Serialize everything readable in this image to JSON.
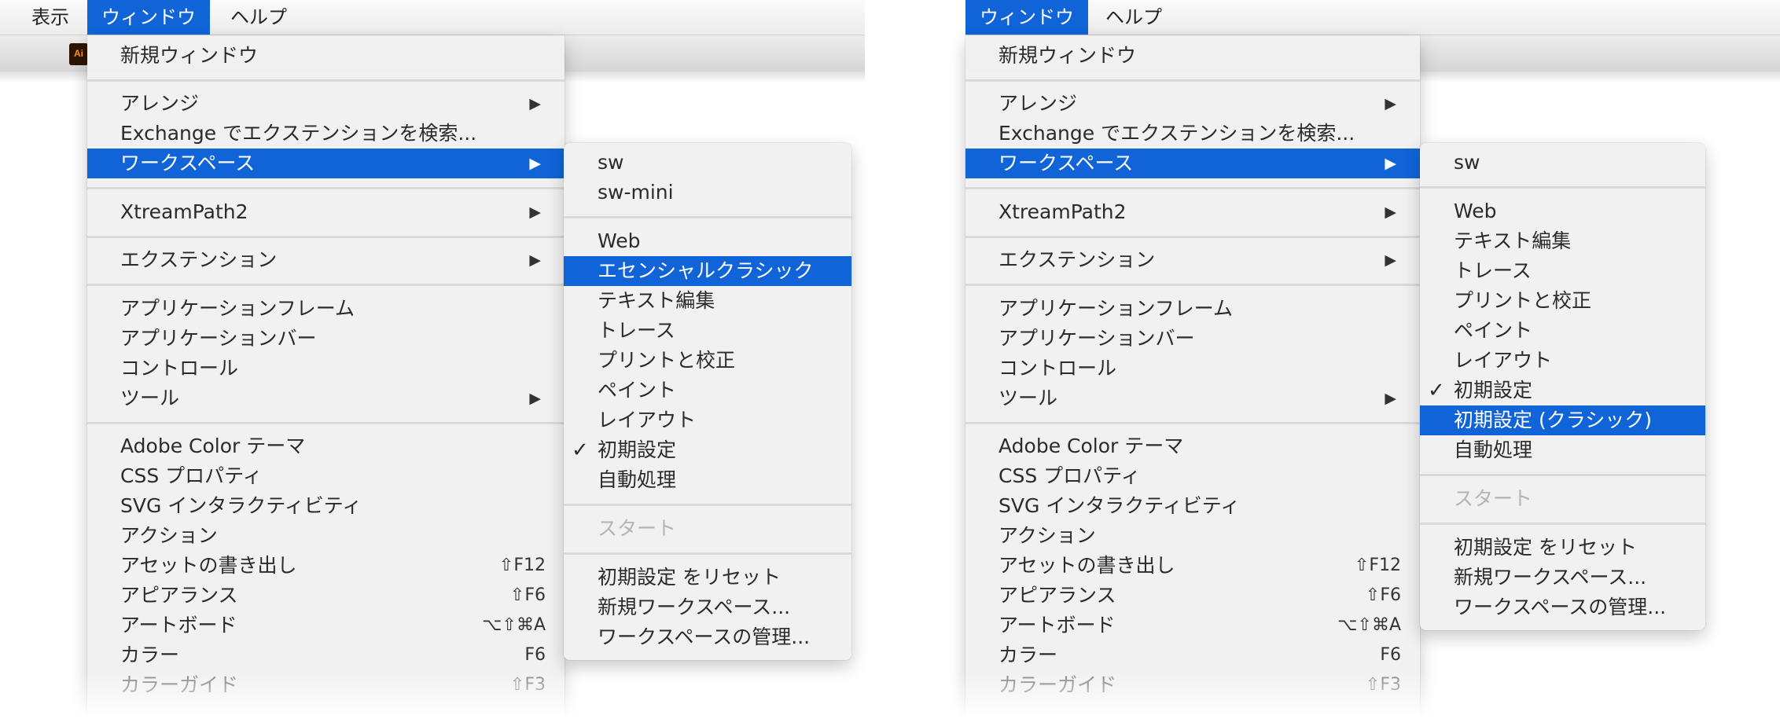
{
  "left": {
    "menubar": {
      "view": "表示",
      "window": "ウィンドウ",
      "help": "ヘルプ"
    },
    "app_icon": "Ai",
    "main_menu": {
      "new_window": "新規ウィンドウ",
      "arrange": "アレンジ",
      "exchange": "Exchange でエクステンションを検索...",
      "workspace": "ワークスペース",
      "xtreampath": "XtreamPath2",
      "extensions": "エクステンション",
      "app_frame": "アプリケーションフレーム",
      "app_bar": "アプリケーションバー",
      "control": "コントロール",
      "tools": "ツール",
      "adobe_color": "Adobe Color テーマ",
      "css_props": "CSS プロパティ",
      "svg_interactivity": "SVG インタラクティビティ",
      "actions": "アクション",
      "asset_export": "アセットの書き出し",
      "asset_export_sc": "⇧F12",
      "appearance": "アピアランス",
      "appearance_sc": "⇧F6",
      "artboards": "アートボード",
      "artboards_sc": "⌥⇧⌘A",
      "color": "カラー",
      "color_sc": "F6",
      "color_guide": "カラーガイド",
      "color_guide_sc": "⇧F3"
    },
    "submenu": {
      "items": [
        "sw",
        "sw-mini",
        "Web",
        "エセンシャルクラシック",
        "テキスト編集",
        "トレース",
        "プリントと校正",
        "ペイント",
        "レイアウト",
        "初期設定",
        "自動処理"
      ],
      "start": "スタート",
      "reset": "初期設定 をリセット",
      "new_ws": "新規ワークスペース...",
      "manage": "ワークスペースの管理..."
    }
  },
  "right": {
    "menubar": {
      "window": "ウィンドウ",
      "help": "ヘルプ"
    },
    "main_menu": {
      "new_window": "新規ウィンドウ",
      "arrange": "アレンジ",
      "exchange": "Exchange でエクステンションを検索...",
      "workspace": "ワークスペース",
      "xtreampath": "XtreamPath2",
      "extensions": "エクステンション",
      "app_frame": "アプリケーションフレーム",
      "app_bar": "アプリケーションバー",
      "control": "コントロール",
      "tools": "ツール",
      "adobe_color": "Adobe Color テーマ",
      "css_props": "CSS プロパティ",
      "svg_interactivity": "SVG インタラクティビティ",
      "actions": "アクション",
      "asset_export": "アセットの書き出し",
      "asset_export_sc": "⇧F12",
      "appearance": "アピアランス",
      "appearance_sc": "⇧F6",
      "artboards": "アートボード",
      "artboards_sc": "⌥⇧⌘A",
      "color": "カラー",
      "color_sc": "F6",
      "color_guide": "カラーガイド",
      "color_guide_sc": "⇧F3"
    },
    "submenu": {
      "items": [
        "sw",
        "Web",
        "テキスト編集",
        "トレース",
        "プリントと校正",
        "ペイント",
        "レイアウト",
        "初期設定",
        "初期設定 (クラシック)",
        "自動処理"
      ],
      "start": "スタート",
      "reset": "初期設定 をリセット",
      "new_ws": "新規ワークスペース...",
      "manage": "ワークスペースの管理..."
    }
  },
  "symbols": {
    "arrow": "▶",
    "check": "✓"
  },
  "colors": {
    "highlight": "#1064d8",
    "menu_bg": "#f1f1f1",
    "disabled_text": "#b4b4b4"
  }
}
